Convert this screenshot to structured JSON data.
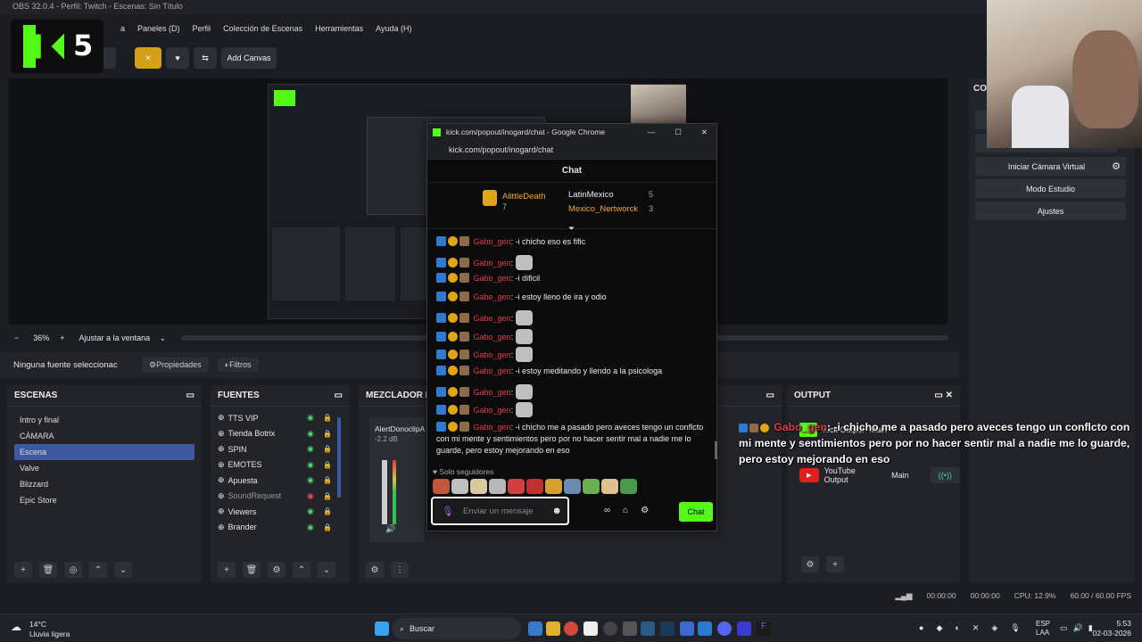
{
  "window": {
    "title": "OBS 32.0.4 - Perfil: Twitch - Escenas: Sin Título"
  },
  "menu": [
    "a",
    "Paneles (D)",
    "Perfil",
    "Colección de Escenas",
    "Herramientas",
    "Ayuda (H)"
  ],
  "logo": {
    "text": "5"
  },
  "toolbar": {
    "add_canvas": "Add Canvas"
  },
  "zoom": {
    "value": "36%",
    "fit": "Ajustar a la ventana",
    "minus": "−",
    "plus": "+"
  },
  "source_bar": {
    "none_selected": "Ninguna fuente seleccionac",
    "properties": "Propiedades",
    "filters": "Filtros"
  },
  "panels": {
    "scenes": {
      "title": "ESCENAS",
      "items": [
        "Intro y final",
        "CÁMARA",
        "Escena",
        "Valve",
        "Blizzard",
        "Epic Store"
      ],
      "selected": 2
    },
    "sources": {
      "title": "FUENTES",
      "items": [
        {
          "label": "TTS VIP",
          "visible": true
        },
        {
          "label": "Tienda Botrix",
          "visible": true
        },
        {
          "label": "SPIN",
          "visible": true
        },
        {
          "label": "EMOTES",
          "visible": true
        },
        {
          "label": "Apuesta",
          "visible": true
        },
        {
          "label": "SoundRequest",
          "visible": false
        },
        {
          "label": "Viewers",
          "visible": true
        },
        {
          "label": "Brander",
          "visible": true
        }
      ]
    },
    "mixer": {
      "title": "MEZCLADOR DE A",
      "track_name": "AlertDonoclipAr",
      "db": "-2.2 dB"
    },
    "output": {
      "title": "OUTPUT",
      "rows": [
        {
          "label": "Kick Output",
          "canvas": "Main"
        },
        {
          "label": "YouTube Output",
          "canvas": "Main"
        }
      ]
    }
  },
  "controls": {
    "title": "CON",
    "virtual_cam": "Iniciar Cámara Virtual",
    "studio": "Modo Estudio",
    "settings": "Ajustes"
  },
  "status": {
    "t1": "00:00:00",
    "t2": "00:00:00",
    "cpu": "CPU: 12.9%",
    "fps": "60.00 / 60.00 FPS"
  },
  "chat": {
    "window_title": "kick.com/popout/inogard/chat - Google Chrome",
    "url": "kick.com/popout/inogard/chat",
    "header": "Chat",
    "leaders": [
      {
        "name": "AlittleDeath",
        "count": "7"
      },
      {
        "name": "LatinMexico",
        "count": "5"
      },
      {
        "name": "Mexico_Nertworck",
        "count": "3"
      }
    ],
    "messages": [
      {
        "user": "Gabo_gen",
        "text": ": -i chicho eso es fific",
        "emote": false
      },
      {
        "user": "Gabo_gen",
        "text": ":",
        "emote": true
      },
      {
        "user": "Gabo_gen",
        "text": ": -i dificil",
        "emote": false
      },
      {
        "user": "Gabo_gen",
        "text": ": -i estoy lleno de ira y odio",
        "emote": false
      },
      {
        "user": "Gabo_gen",
        "text": ":",
        "emote": true
      },
      {
        "user": "Gabo_gen",
        "text": ":",
        "emote": true
      },
      {
        "user": "Gabo_gen",
        "text": ":",
        "emote": true
      },
      {
        "user": "Gabo_gen",
        "text": ": -i estoy meditando y llendo a la psicologa",
        "emote": false
      },
      {
        "user": "Gabo_gen",
        "text": ":",
        "emote": true
      },
      {
        "user": "Gabo_gen",
        "text": ":",
        "emote": true
      }
    ],
    "last_message": {
      "user": "Gabo_gen",
      "text": ": -i chicho me a pasado pero aveces tengo un conflcto con mi mente y sentimientos pero por no hacer sentir mal a nadie me lo guarde, pero estoy mejorando en eso"
    },
    "followers_only": "Solo seguidores",
    "input_placeholder": "Enviar un mensaje",
    "send": "Chat"
  },
  "overlay": {
    "user": "Gabo_gen",
    "text": ": -i chicho me a pasado pero aveces tengo un conflcto con mi mente y sentimientos pero por no hacer sentir mal a nadie me lo guarde, pero estoy mejorando en eso"
  },
  "taskbar": {
    "temp": "14°C",
    "weather": "Lluvia ligera",
    "search": "Buscar",
    "lang1": "ESP",
    "lang2": "LAA",
    "time": "5:53",
    "date": "02-03-2026"
  }
}
